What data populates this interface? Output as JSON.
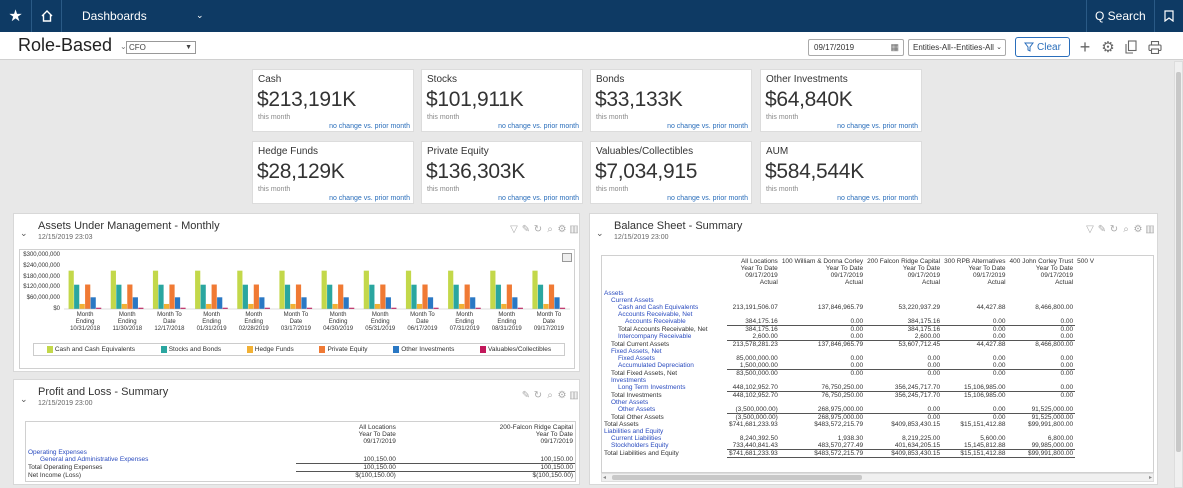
{
  "nav": {
    "dashboards_label": "Dashboards",
    "search_label": "Q Search"
  },
  "page": {
    "title": "Role-Based",
    "role": "CFO",
    "date": "09/17/2019",
    "entities": "Entities-All--Entities-All",
    "clear_label": "Clear"
  },
  "kpis": [
    {
      "name": "Cash",
      "value": "$213,191K",
      "period": "this month",
      "change": "no change vs. prior month"
    },
    {
      "name": "Stocks",
      "value": "$101,911K",
      "period": "this month",
      "change": "no change vs. prior month"
    },
    {
      "name": "Bonds",
      "value": "$33,133K",
      "period": "this month",
      "change": "no change vs. prior month"
    },
    {
      "name": "Other Investments",
      "value": "$64,840K",
      "period": "this month",
      "change": "no change vs. prior month"
    },
    {
      "name": "Hedge Funds",
      "value": "$28,129K",
      "period": "this month",
      "change": "no change vs. prior month"
    },
    {
      "name": "Private Equity",
      "value": "$136,303K",
      "period": "this month",
      "change": "no change vs. prior month"
    },
    {
      "name": "Valuables/Collectibles",
      "value": "$7,034,915",
      "period": "this month",
      "change": "no change vs. prior month"
    },
    {
      "name": "AUM",
      "value": "$584,544K",
      "period": "this month",
      "change": "no change vs. prior month"
    }
  ],
  "aum_panel": {
    "title": "Assets Under Management - Monthly",
    "date": "12/15/2019 23:03"
  },
  "pl_panel": {
    "title": "Profit and Loss - Summary",
    "date": "12/15/2019 23:00"
  },
  "bs_panel": {
    "title": "Balance Sheet - Summary",
    "date": "12/15/2019 23:00"
  },
  "chart_data": {
    "type": "bar",
    "ylim": [
      0,
      300000000
    ],
    "y_ticks": [
      "$300,000,000",
      "$240,000,000",
      "$180,000,000",
      "$120,000,000",
      "$60,000,000",
      "$0"
    ],
    "categories": [
      [
        "Month",
        "Ending",
        "10/31/2018"
      ],
      [
        "Month",
        "Ending",
        "11/30/2018"
      ],
      [
        "Month To",
        "Date",
        "12/17/2018"
      ],
      [
        "Month",
        "Ending",
        "01/31/2019"
      ],
      [
        "Month",
        "Ending",
        "02/28/2019"
      ],
      [
        "Month To",
        "Date",
        "03/17/2019"
      ],
      [
        "Month",
        "Ending",
        "04/30/2019"
      ],
      [
        "Month",
        "Ending",
        "05/31/2019"
      ],
      [
        "Month To",
        "Date",
        "06/17/2019"
      ],
      [
        "Month",
        "Ending",
        "07/31/2019"
      ],
      [
        "Month",
        "Ending",
        "08/31/2019"
      ],
      [
        "Month To",
        "Date",
        "09/17/2019"
      ]
    ],
    "series": [
      {
        "name": "Cash and Cash Equivalents",
        "color": "#c3d84a",
        "values": [
          213000000,
          213000000,
          213000000,
          213000000,
          213000000,
          213000000,
          213000000,
          213000000,
          213000000,
          213000000,
          213000000,
          213000000
        ]
      },
      {
        "name": "Stocks and Bonds",
        "color": "#2aa6a0",
        "values": [
          135000000,
          135000000,
          135000000,
          135000000,
          135000000,
          135000000,
          135000000,
          135000000,
          135000000,
          135000000,
          135000000,
          135000000
        ]
      },
      {
        "name": "Hedge Funds",
        "color": "#f2b134",
        "values": [
          28000000,
          28000000,
          28000000,
          28000000,
          28000000,
          28000000,
          28000000,
          28000000,
          28000000,
          28000000,
          28000000,
          28000000
        ]
      },
      {
        "name": "Private Equity",
        "color": "#f07a34",
        "values": [
          136000000,
          136000000,
          136000000,
          136000000,
          136000000,
          136000000,
          136000000,
          136000000,
          136000000,
          136000000,
          136000000,
          136000000
        ]
      },
      {
        "name": "Other Investments",
        "color": "#2a78c4",
        "values": [
          65000000,
          65000000,
          65000000,
          65000000,
          65000000,
          65000000,
          65000000,
          65000000,
          65000000,
          65000000,
          65000000,
          65000000
        ]
      },
      {
        "name": "Valuables/Collectibles",
        "color": "#c2185b",
        "values": [
          7000000,
          7000000,
          7000000,
          7000000,
          7000000,
          7000000,
          7000000,
          7000000,
          7000000,
          7000000,
          7000000,
          7000000
        ]
      }
    ]
  },
  "pl": {
    "header": [
      "",
      "All Locations\nYear To Date\n09/17/2019",
      "200-Falcon Ridge Capital\nYear To Date\n09/17/2019"
    ],
    "rows": [
      {
        "label": "Operating Expenses",
        "indent": 0,
        "blue": true,
        "vals": [
          "",
          ""
        ]
      },
      {
        "label": "General and Administrative Expenses",
        "indent": 2,
        "blue": true,
        "vals": [
          "100,150.00",
          "100,150.00"
        ]
      },
      {
        "label": "Total Operating Expenses",
        "indent": 0,
        "blue": false,
        "vals": [
          "100,150.00",
          "100,150.00"
        ]
      },
      {
        "label": "Net Income (Loss)",
        "indent": 0,
        "blue": false,
        "vals": [
          "$(100,150.00)",
          "$(100,150.00)"
        ]
      }
    ]
  },
  "bs": {
    "columns": [
      "All Locations\nYear To Date\n09/17/2019\nActual",
      "100 William & Donna Corley\nYear To Date\n09/17/2019\nActual",
      "200 Falcon Ridge Capital\nYear To Date\n09/17/2019\nActual",
      "300 RPB Alternatives\nYear To Date\n09/17/2019\nActual",
      "400 John Corley Trust\nYear To Date\n09/17/2019\nActual",
      "500 V"
    ],
    "rows": [
      {
        "label": "Assets",
        "indent": 0,
        "blue": true,
        "vals": [
          "",
          "",
          "",
          "",
          ""
        ]
      },
      {
        "label": "Current Assets",
        "indent": 1,
        "blue": true,
        "vals": [
          "",
          "",
          "",
          "",
          ""
        ]
      },
      {
        "label": "Cash and Cash Equivalents",
        "indent": 2,
        "blue": true,
        "vals": [
          "213,191,506.07",
          "137,846,965.79",
          "53,220,937.29",
          "44,427.88",
          "8,466,800.00"
        ]
      },
      {
        "label": "Accounts Receivable, Net",
        "indent": 2,
        "blue": true,
        "vals": [
          "",
          "",
          "",
          "",
          ""
        ]
      },
      {
        "label": "Accounts Receivable",
        "indent": 3,
        "blue": true,
        "vals": [
          "384,175.16",
          "0.00",
          "384,175.16",
          "0.00",
          "0.00"
        ]
      },
      {
        "label": "Total Accounts Receivable, Net",
        "indent": 2,
        "blue": false,
        "vals": [
          "384,175.16",
          "0.00",
          "384,175.16",
          "0.00",
          "0.00"
        ]
      },
      {
        "label": "Intercompany Receivable",
        "indent": 2,
        "blue": true,
        "vals": [
          "2,600.00",
          "0.00",
          "2,600.00",
          "0.00",
          "0.00"
        ]
      },
      {
        "label": "Total Current Assets",
        "indent": 1,
        "blue": false,
        "vals": [
          "213,578,281.23",
          "137,846,965.79",
          "53,607,712.45",
          "44,427.88",
          "8,466,800.00"
        ]
      },
      {
        "label": "Fixed Assets, Net",
        "indent": 1,
        "blue": true,
        "vals": [
          "",
          "",
          "",
          "",
          ""
        ]
      },
      {
        "label": "Fixed Assets",
        "indent": 2,
        "blue": true,
        "vals": [
          "85,000,000.00",
          "0.00",
          "0.00",
          "0.00",
          "0.00"
        ]
      },
      {
        "label": "Accumulated Depreciation",
        "indent": 2,
        "blue": true,
        "vals": [
          "1,500,000.00",
          "0.00",
          "0.00",
          "0.00",
          "0.00"
        ]
      },
      {
        "label": "Total Fixed Assets, Net",
        "indent": 1,
        "blue": false,
        "vals": [
          "83,500,000.00",
          "0.00",
          "0.00",
          "0.00",
          "0.00"
        ]
      },
      {
        "label": "Investments",
        "indent": 1,
        "blue": true,
        "vals": [
          "",
          "",
          "",
          "",
          ""
        ]
      },
      {
        "label": "Long Term Investments",
        "indent": 2,
        "blue": true,
        "vals": [
          "448,102,952.70",
          "76,750,250.00",
          "356,245,717.70",
          "15,106,985.00",
          "0.00"
        ]
      },
      {
        "label": "Total Investments",
        "indent": 1,
        "blue": false,
        "vals": [
          "448,102,952.70",
          "76,750,250.00",
          "356,245,717.70",
          "15,106,985.00",
          "0.00"
        ]
      },
      {
        "label": "Other Assets",
        "indent": 1,
        "blue": true,
        "vals": [
          "",
          "",
          "",
          "",
          ""
        ]
      },
      {
        "label": "Other Assets",
        "indent": 2,
        "blue": true,
        "vals": [
          "(3,500,000.00)",
          "268,975,000.00",
          "0.00",
          "0.00",
          "91,525,000.00"
        ]
      },
      {
        "label": "Total Other Assets",
        "indent": 1,
        "blue": false,
        "vals": [
          "(3,500,000.00)",
          "268,975,000.00",
          "0.00",
          "0.00",
          "91,525,000.00"
        ]
      },
      {
        "label": "Total Assets",
        "indent": 0,
        "blue": false,
        "vals": [
          "$741,681,233.93",
          "$483,572,215.79",
          "$409,853,430.15",
          "$15,151,412.88",
          "$99,991,800.00"
        ]
      },
      {
        "label": "Liabilities and Equity",
        "indent": 0,
        "blue": true,
        "vals": [
          "",
          "",
          "",
          "",
          ""
        ]
      },
      {
        "label": "Current Liabilities",
        "indent": 1,
        "blue": true,
        "vals": [
          "8,240,392.50",
          "1,938.30",
          "8,219,225.00",
          "5,600.00",
          "6,800.00"
        ]
      },
      {
        "label": "Stockholders Equity",
        "indent": 1,
        "blue": true,
        "vals": [
          "733,440,841.43",
          "483,570,277.49",
          "401,634,205.15",
          "15,145,812.88",
          "99,985,000.00"
        ]
      },
      {
        "label": "Total Liabilities and Equity",
        "indent": 0,
        "blue": false,
        "vals": [
          "$741,681,233.93",
          "$483,572,215.79",
          "$409,853,430.15",
          "$15,151,412.88",
          "$99,991,800.00"
        ]
      }
    ]
  }
}
